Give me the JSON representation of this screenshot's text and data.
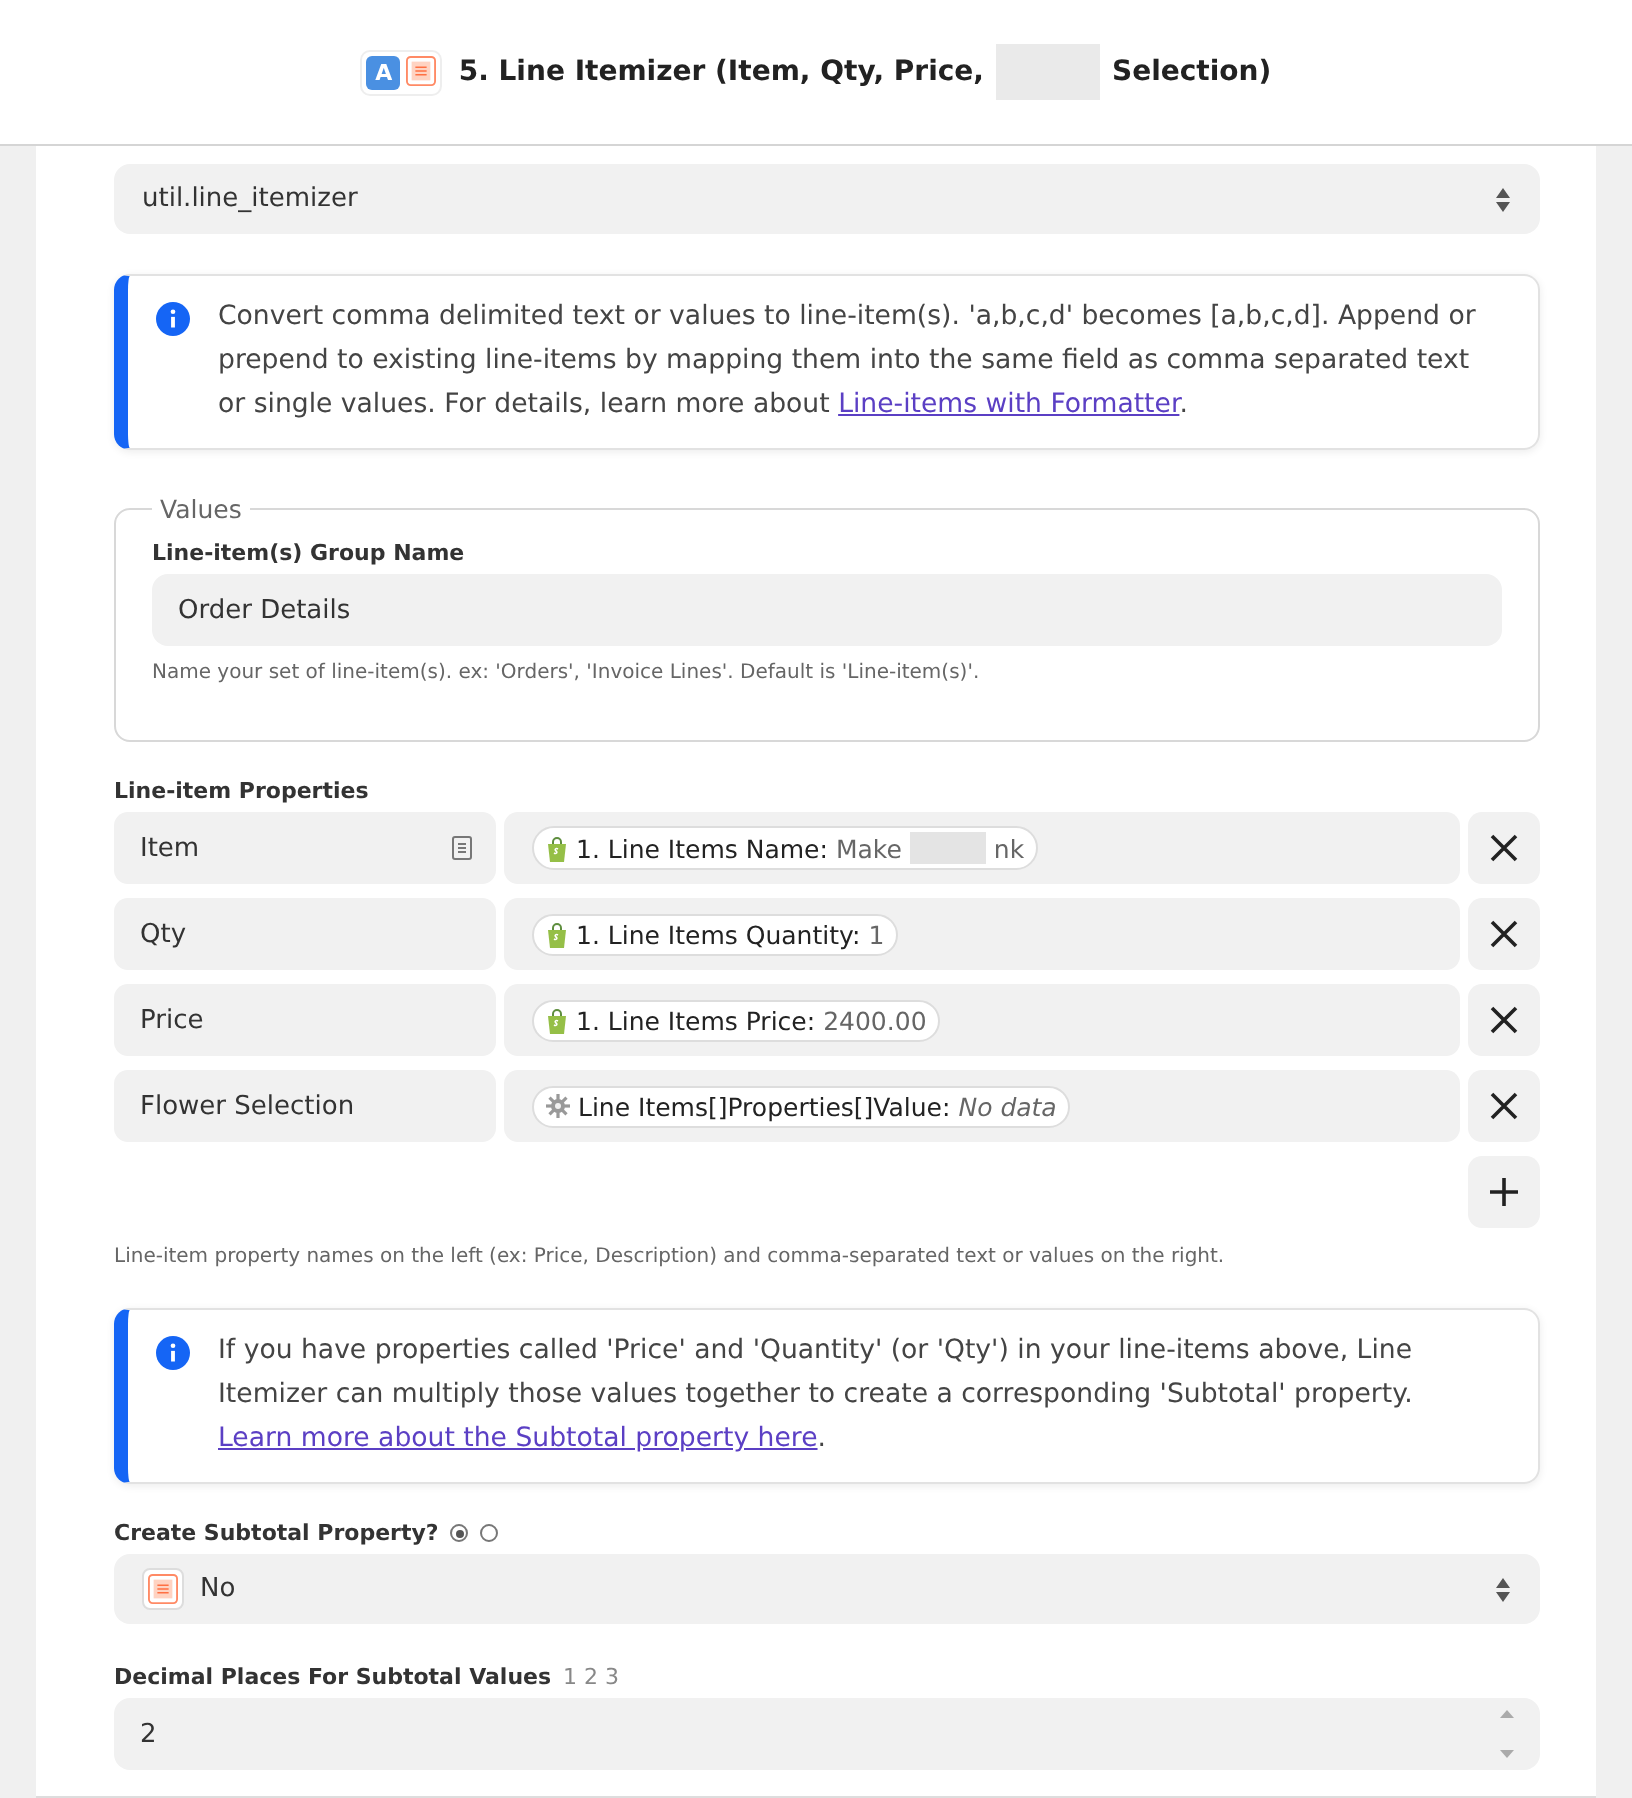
{
  "header": {
    "app_badge": "A",
    "title": "5. Line Itemizer (Item, Qty, Price,",
    "title_end": "Selection)"
  },
  "transform_select": {
    "value": "util.line_itemizer"
  },
  "info_1": {
    "text": "Convert comma delimited text or values to line-item(s). 'a,b,c,d' becomes [a,b,c,d]. Append or prepend to existing line-items by mapping them into the same field as comma separated text or single values. For details, learn more about ",
    "link": "Line-items with Formatter",
    "after": "."
  },
  "values_group": {
    "legend": "Values",
    "label": "Line-item(s) Group Name",
    "value": "Order Details",
    "help": "Name your set of line-item(s). ex: 'Orders', 'Invoice Lines'. Default is 'Line-item(s)'."
  },
  "properties": {
    "label": "Line-item Properties",
    "help": "Line-item property names on the left (ex: Price, Description) and comma-separated text or values on the right.",
    "rows": [
      {
        "name": "Item",
        "has_doc_icon": true,
        "kind": "shop",
        "pill_label": "1. Line Items Name:",
        "pill_value": "Make",
        "pill_value_end": "nk",
        "redacted": true,
        "empty": false
      },
      {
        "name": "Qty",
        "has_doc_icon": false,
        "kind": "shop",
        "pill_label": "1. Line Items Quantity:",
        "pill_value": "1",
        "redacted": false,
        "empty": false
      },
      {
        "name": "Price",
        "has_doc_icon": false,
        "kind": "shop",
        "pill_label": "1. Line Items Price:",
        "pill_value": "2400.00",
        "redacted": false,
        "empty": false
      },
      {
        "name": "Flower Selection",
        "has_doc_icon": false,
        "kind": "gear",
        "pill_label": "Line Items[]Properties[]Value:",
        "pill_value": "No data",
        "redacted": false,
        "empty": true
      }
    ]
  },
  "info_2": {
    "text": "If you have properties called 'Price' and 'Quantity' (or 'Qty') in your line-items above, Line Itemizer can multiply those values together to create a corresponding 'Subtotal' property. ",
    "link": "Learn more about the Subtotal property here",
    "after": "."
  },
  "subtotal": {
    "label": "Create Subtotal Property?",
    "radios": [
      {
        "selected": true
      },
      {
        "selected": false
      }
    ],
    "value": "No"
  },
  "decimal": {
    "label": "Decimal Places For Subtotal Values",
    "hint": "1 2 3",
    "value": "2"
  }
}
